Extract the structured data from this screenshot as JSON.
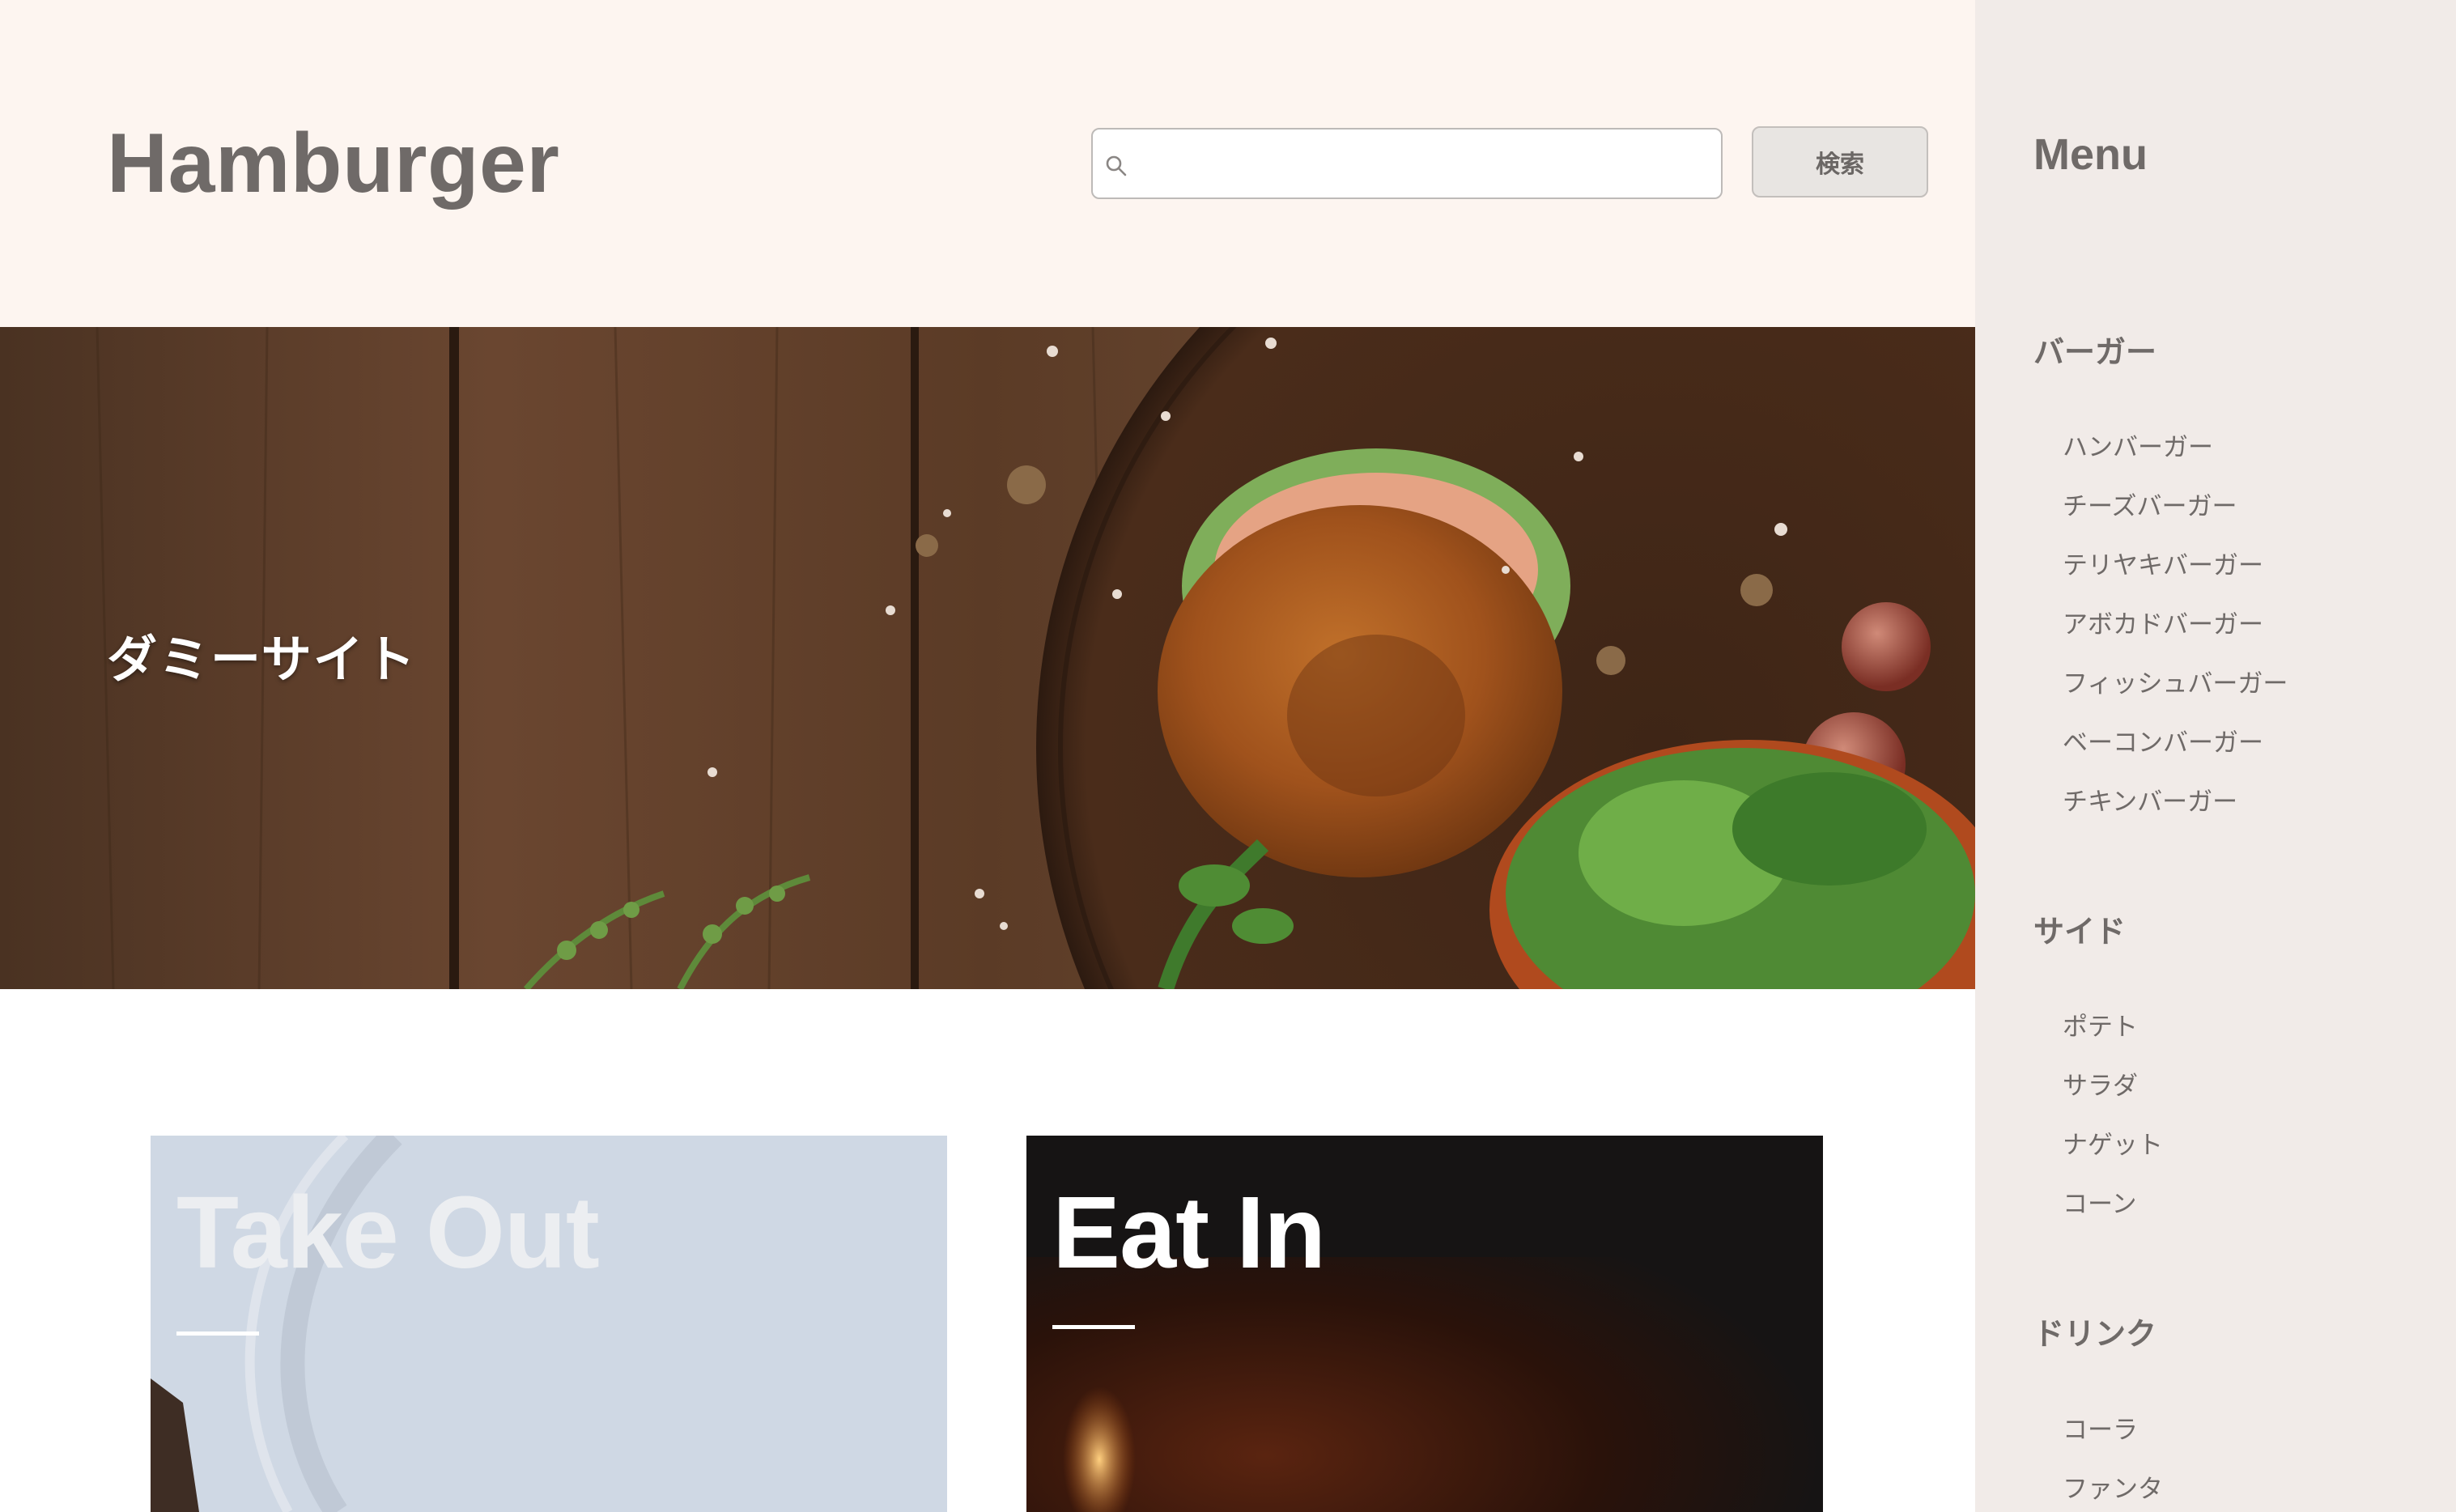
{
  "header": {
    "logo": "Hamburger",
    "search": {
      "value": "",
      "placeholder": ""
    },
    "search_button_label": "検索"
  },
  "hero": {
    "title": "ダミーサイト"
  },
  "cards": [
    {
      "title": "Take Out"
    },
    {
      "title": "Eat In"
    }
  ],
  "sidebar": {
    "title": "Menu",
    "sections": [
      {
        "heading": "バーガー",
        "items": [
          "ハンバーガー",
          "チーズバーガー",
          "テリヤキバーガー",
          "アボカドバーガー",
          "フィッシュバーガー",
          "ベーコンバーガー",
          "チキンバーガー"
        ]
      },
      {
        "heading": "サイド",
        "items": [
          "ポテト",
          "サラダ",
          "ナゲット",
          "コーン"
        ]
      },
      {
        "heading": "ドリンク",
        "items": [
          "コーラ",
          "ファンタ"
        ]
      }
    ]
  },
  "icons": {
    "search": "search-icon"
  },
  "colors": {
    "header_bg": "#fdf5f0",
    "sidebar_bg": "#f1ebe8",
    "text_gray": "#6f6a68",
    "button_bg": "#e8e5e2"
  }
}
